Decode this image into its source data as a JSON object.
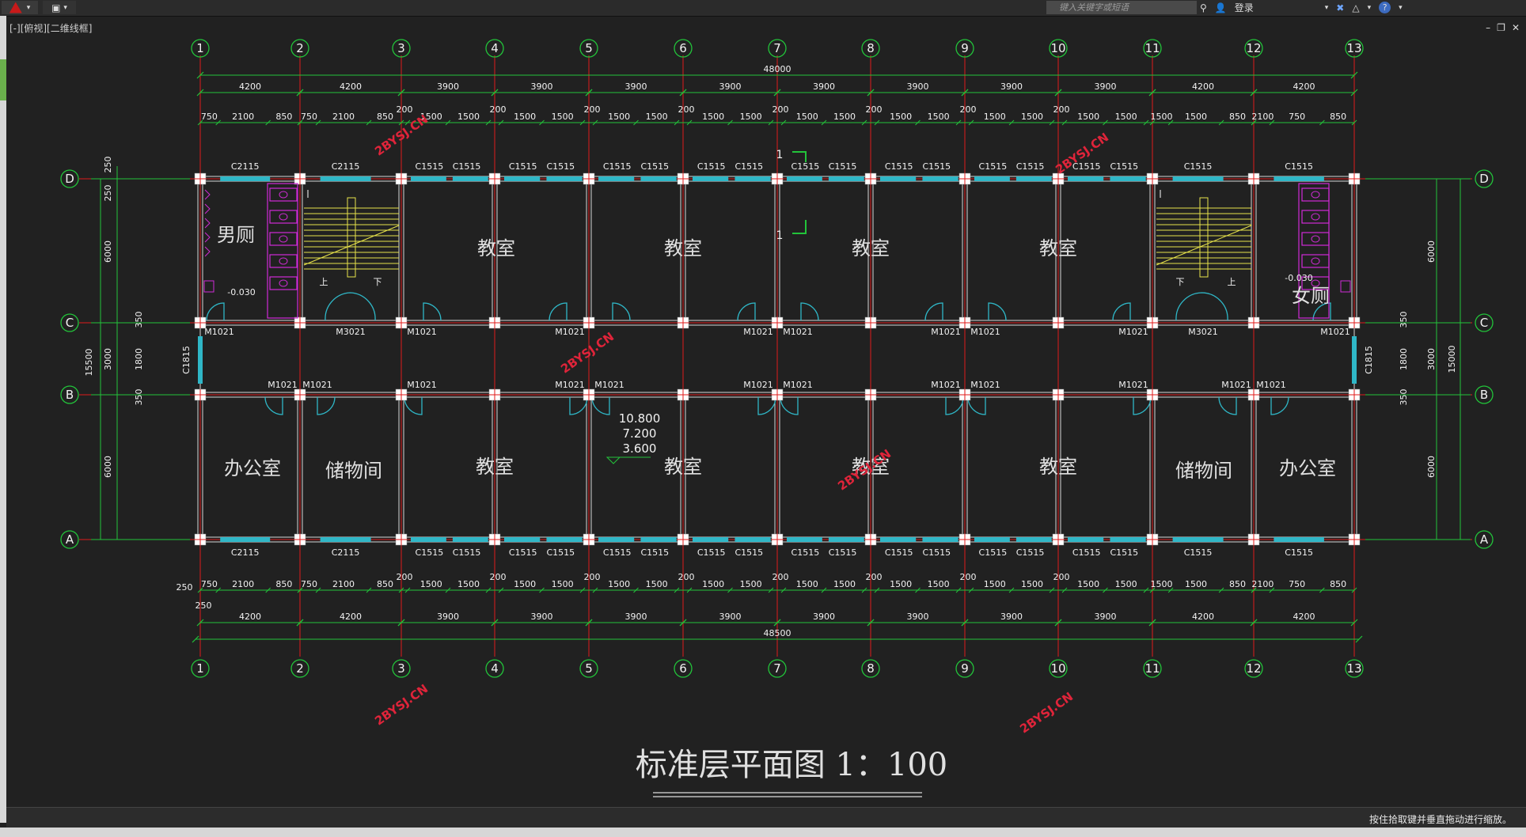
{
  "toolbar": {
    "search_placeholder": "键入关键字或短语",
    "login_label": "登录",
    "help_label": "?"
  },
  "viewport_label": "[-][俯视][二维线框]",
  "window_controls": [
    "–",
    "❐",
    "✕"
  ],
  "status_message": "按住拾取键并垂直拖动进行缩放。",
  "drawing": {
    "title": "标准层平面图",
    "scale": "1：100",
    "column_axes": [
      "1",
      "2",
      "3",
      "4",
      "5",
      "6",
      "7",
      "8",
      "9",
      "10",
      "11",
      "12",
      "13"
    ],
    "row_axes": [
      "A",
      "B",
      "C",
      "D"
    ],
    "overall_top": "48000",
    "overall_bottom": "48500",
    "bay_dims": [
      "4200",
      "4200",
      "3900",
      "3900",
      "3900",
      "3900",
      "3900",
      "3900",
      "3900",
      "3900",
      "4200",
      "4200"
    ],
    "sub_dims_top": [
      "750",
      "2100",
      "850",
      "750",
      "2100",
      "850",
      "1500",
      "1500",
      "1500",
      "1500",
      "1500",
      "1500",
      "1500",
      "1500",
      "1500",
      "1500",
      "1500",
      "1500",
      "1500",
      "1500",
      "1500",
      "1500",
      "1500",
      "1500",
      "850",
      "2100",
      "750",
      "850",
      "2100",
      "750"
    ],
    "pier_dim": "200",
    "edge_dim": "250",
    "left_dims": [
      "250",
      "250",
      "6000",
      "350",
      "1800",
      "3000",
      "15500",
      "350",
      "6000"
    ],
    "right_dims": [
      "6000",
      "350",
      "1800",
      "3000",
      "15000",
      "350",
      "6000"
    ],
    "windows_top": [
      "C2115",
      "C2115",
      "C1515",
      "C1515",
      "C1515",
      "C1515",
      "C1515",
      "C1515",
      "C1515",
      "C1515",
      "C1515",
      "C1515",
      "C1515",
      "C1515",
      "C1515",
      "C1515",
      "C1515",
      "C1515",
      "C1515",
      "C1515",
      "C2115",
      "C2115"
    ],
    "windows_bottom": [
      "C2115",
      "C2115",
      "C1515",
      "C1515",
      "C1515",
      "C1515",
      "C1515",
      "C1515",
      "C1515",
      "C1515",
      "C1515",
      "C1515",
      "C1515",
      "C1515",
      "C1515",
      "C1515",
      "C1515",
      "C1515",
      "C1515",
      "C1515",
      "C2115",
      "C2115"
    ],
    "side_windows": [
      "C1815",
      "C1815"
    ],
    "doors_c": [
      "M1021",
      "M3021",
      "M1021",
      "M1021",
      "M1021",
      "M1021",
      "M1021",
      "M1021",
      "M1021",
      "M3021",
      "M1021"
    ],
    "doors_b": [
      "M1021",
      "M1021",
      "M1021",
      "M1021",
      "M1021",
      "M1021",
      "M1021",
      "M1021",
      "M1021",
      "M1021",
      "M1021",
      "M1021"
    ],
    "rooms": {
      "mens_wc": "男厕",
      "womens_wc": "女厕",
      "classroom": "教室",
      "office": "办公室",
      "storage": "储物间"
    },
    "levels": [
      "10.800",
      "7.200",
      "3.600"
    ],
    "wc_level": "-0.030",
    "stair_up": "上",
    "stair_down": "下",
    "section_mark": "1",
    "watermark": "2BYSJ.CN"
  },
  "colors": {
    "background": "#212121",
    "dimension_green": "#22c43a",
    "axis_red": "#e01a1a",
    "wall": "#d8d8d8",
    "window_cyan": "#2fb7c7",
    "stair_yellow": "#e7e34a",
    "fixture_magenta": "#d02bd6",
    "watermark_red": "#e0243a"
  }
}
